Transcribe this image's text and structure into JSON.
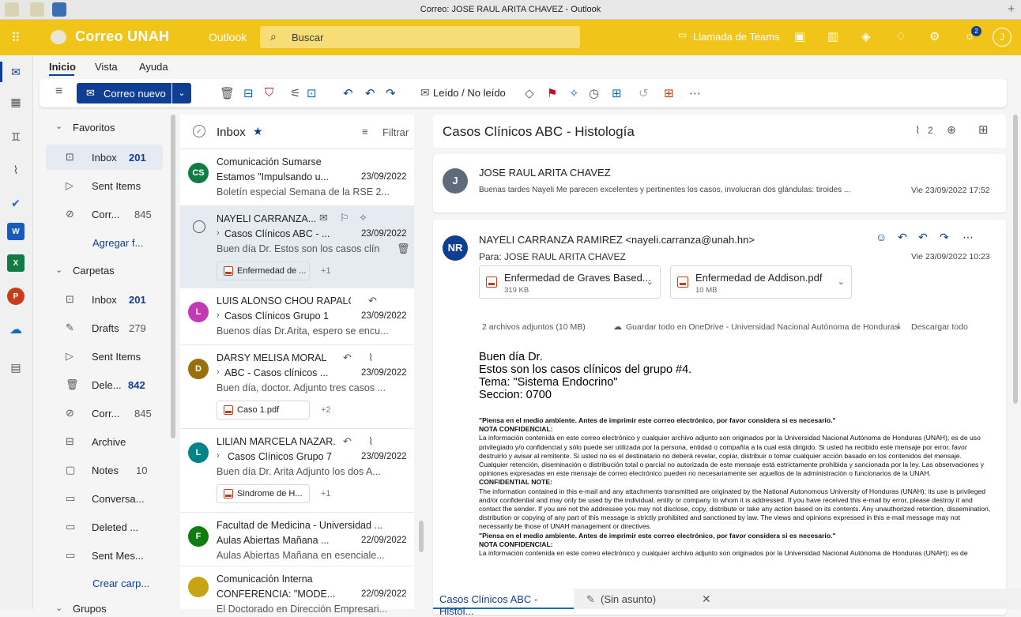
{
  "window_title": "Correo: JOSE RAUL ARITA CHAVEZ - Outlook",
  "brand": "Correo UNAH",
  "app_name": "Outlook",
  "search_placeholder": "Buscar",
  "teams_call": "Llamada de Teams",
  "notif_count": "2",
  "user_initial": "J",
  "menu": [
    "Inicio",
    "Vista",
    "Ayuda"
  ],
  "ribbon": {
    "new_mail": "Correo nuevo",
    "read_unread": "Leído / No leído"
  },
  "nav": {
    "favorites_label": "Favoritos",
    "fav_items": [
      {
        "label": "Inbox",
        "count": "201"
      },
      {
        "label": "Sent Items",
        "count": ""
      },
      {
        "label": "Corr...",
        "count": "845"
      }
    ],
    "add_favorite": "Agregar f...",
    "folders_label": "Carpetas",
    "folder_items": [
      {
        "label": "Inbox",
        "count": "201"
      },
      {
        "label": "Drafts",
        "count": "279"
      },
      {
        "label": "Sent Items",
        "count": ""
      },
      {
        "label": "Dele...",
        "count": "842"
      },
      {
        "label": "Corr...",
        "count": "845"
      },
      {
        "label": "Archive",
        "count": ""
      },
      {
        "label": "Notes",
        "count": "10"
      },
      {
        "label": "Conversa...",
        "count": ""
      },
      {
        "label": "Deleted ...",
        "count": ""
      },
      {
        "label": "Sent Mes...",
        "count": ""
      }
    ],
    "create_folder": "Crear carp...",
    "groups_label": "Grupos"
  },
  "list": {
    "title": "Inbox",
    "filter": "Filtrar",
    "messages": [
      {
        "initials": "CS",
        "color": "#107c41",
        "from": "Comunicación Sumarse",
        "subject": "Estamos \"Impulsando u...",
        "date": "23/09/2022",
        "preview": "Boletín especial Semana de la RSE 2..."
      },
      {
        "initials": "",
        "color": "",
        "from": "NAYELI CARRANZA...",
        "subject": "Casos Clínicos ABC - ...",
        "date": "23/09/2022",
        "preview": "Buen día Dr. Estos son los casos clíni...",
        "attachment": "Enfermedad de ...",
        "more": "+1"
      },
      {
        "initials": "L",
        "color": "#c239b3",
        "from": "LUIS ALONSO CHOU RAPALO",
        "subject": "Casos Clínicos Grupo 1",
        "date": "23/09/2022",
        "preview": "Buenos días Dr.Arita, espero se encu..."
      },
      {
        "initials": "D",
        "color": "#986f0b",
        "from": "DARSY MELISA MORALE...",
        "subject": "ABC - Casos clínicos ...",
        "date": "23/09/2022",
        "preview": "Buen día, doctor. Adjunto tres casos ...",
        "attachment": "Caso 1.pdf",
        "more": "+2"
      },
      {
        "initials": "L",
        "color": "#038387",
        "from": "LILIAN MARCELA NAZAR...",
        "subject": "Casos Clínicos Grupo 7",
        "date": "23/09/2022",
        "preview": "Buen día Dr. Arita Adjunto los dos A...",
        "attachment": "Sindrome de H...",
        "more": "+1"
      },
      {
        "initials": "F",
        "color": "#107c10",
        "from": "Facultad de Medicina - Universidad ...",
        "subject": "Aulas Abiertas Mañana ...",
        "date": "22/09/2022",
        "preview": "Aulas Abiertas Mañana en esenciale..."
      },
      {
        "initials": "",
        "color": "#c8a415",
        "from": "Comunicación Interna",
        "subject": "CONFERENCIA: \"MODE...",
        "date": "22/09/2022",
        "preview": "El Doctorado en Dirección Empresari..."
      }
    ]
  },
  "reading": {
    "subject": "Casos Clínicos ABC - Histología",
    "attach_count": "2",
    "msg1": {
      "initial": "J",
      "from": "JOSE RAUL ARITA CHAVEZ",
      "preview": "Buenas tardes Nayeli Me parecen excelentes y pertinentes los casos, involucran dos glándulas: tiroides ...",
      "date": "Vie 23/09/2022 17:52"
    },
    "msg2": {
      "initial": "NR",
      "from": "NAYELI CARRANZA RAMIREZ <nayeli.carranza@unah.hn>",
      "to": "Para:  JOSE RAUL ARITA CHAVEZ",
      "date": "Vie 23/09/2022 10:23",
      "att1_name": "Enfermedad de Graves Based...",
      "att1_size": "319 KB",
      "att2_name": "Enfermedad de Addison.pdf",
      "att2_size": "10 MB",
      "att_summary": "2 archivos adjuntos (10 MB)",
      "save_onedrive": "Guardar todo en OneDrive - Universidad Nacional Autónoma de Honduras",
      "download_all": "Descargar todo",
      "body": [
        "Buen día Dr.",
        "Estos son los casos clínicos del grupo #4.",
        "Tema: \"Sistema Endocrino\"",
        "Seccion: 0700"
      ],
      "env_note": "\"Piensa en el medio ambiente. Antes de imprimir este correo electrónico, por favor considera si es necesario.\"",
      "conf_title": "NOTA CONFIDENCIAL:",
      "conf_es": "La información contenida en este correo electrónico y cualquier archivo adjunto son originados por la Universidad Nacional Autónoma de Honduras (UNAH); es de uso privilegiado y/o confidencial y sólo puede ser utilizada por la persona, entidad o compañía a la cual está dirigido. Si usted ha recibido este mensaje por error, favor destruirlo y avisar al remitente. Si usted no es el destinatario no deberá revelar, copiar, distribuir o tomar cualquier acción basado en los contenidos del mensaje. Cualquier retención, diseminación o distribución total o parcial no autorizada de este mensaje está estrictamente prohibida y sancionada por la ley. Las observaciones y opiniones expresadas en este mensaje de correo electrónico pueden no necesariamente ser aquellos de la administración o funcionarios de la UNAH.",
      "conf_en_title": "CONFIDENTIAL NOTE:",
      "conf_en": "The information contained in this e-mail and any attachments transmitted are originated by the National Autonomous University of Honduras (UNAH); its use is privileged and/or confidential and may only be used by the individual, entity or company to whom it is addressed. If you have received this e-mail by error, please destroy it and contact the sender. If you are not the addressee you may not disclose, copy, distribute or take any action based on its contents. Any unauthorized retention, dissemination, distribution or copying of any part of this message is strictly prohibited and sanctioned by law. The views and opinions expressed in this e-mail message may not necessarily be those of UNAH management or directives.",
      "env_note2": "\"Piensa en el medio ambiente. Antes de imprimir este correo electrónico, por favor considera si es necesario.\"",
      "conf_title2": "NOTA CONFIDENCIAL:",
      "conf_es2": "La información contenida en este correo electrónico y cualquier archivo adjunto son originados por la Universidad Nacional Autónoma de Honduras (UNAH); es de"
    }
  },
  "tabs": {
    "tab1": "Casos Clínicos ABC - Histol...",
    "tab2": "(Sin asunto)"
  },
  "colors": {
    "accent": "#0f3e95",
    "brand_bar": "#f0c419"
  }
}
